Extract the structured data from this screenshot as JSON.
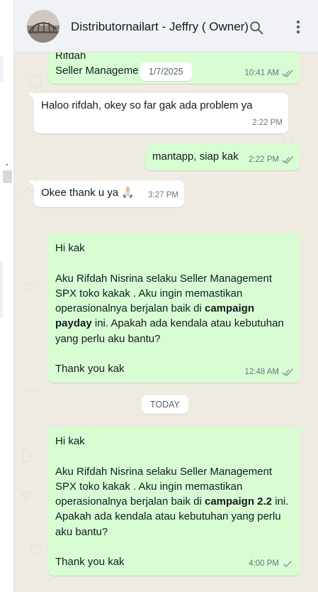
{
  "header": {
    "title": "Distributornailart - Jeffry ( Owner)",
    "avatar_icon": "profile-photo",
    "search_icon": "search-icon",
    "menu_icon": "kebab-menu-icon"
  },
  "messages": {
    "m1": {
      "lines": [
        "Rifdah",
        "Seller Manageme"
      ],
      "time": "10:41 AM",
      "date_overlay": "1/7/2025"
    },
    "m2": {
      "text": "Haloo rifdah, okey so far gak ada problem ya",
      "time": "2:22 PM"
    },
    "m3": {
      "text": "mantapp, siap kak",
      "time": "2:22 PM"
    },
    "m4": {
      "text": "Okee thank u ya 🙏🏻",
      "time": "3:27 PM"
    },
    "m5": {
      "greeting": "Hi kak",
      "body_a": "Aku Rifdah Nisrina selaku Seller Management SPX toko kakak . Aku ingin memastikan operasionalnya berjalan baik di ",
      "bold": "campaign payday",
      "body_b": " ini. Apakah ada kendala atau kebutuhan yang perlu aku bantu?",
      "closing": "Thank you kak",
      "time": "12:48 AM"
    },
    "today_label": "TODAY",
    "m6": {
      "greeting": "Hi kak",
      "body_a": "Aku Rifdah Nisrina selaku Seller Management SPX toko kakak . Aku ingin memastikan operasionalnya berjalan baik di ",
      "bold": "campaign 2.2",
      "body_b": " ini. Apakah ada kendala atau kebutuhan yang perlu aku bantu?",
      "closing": "Thank you kak",
      "time": "4:00 PM"
    }
  },
  "colors": {
    "outgoing": "#d9fdd3",
    "incoming": "#ffffff",
    "chat_bg": "#efeae2",
    "read_tick": "#8696a0"
  }
}
